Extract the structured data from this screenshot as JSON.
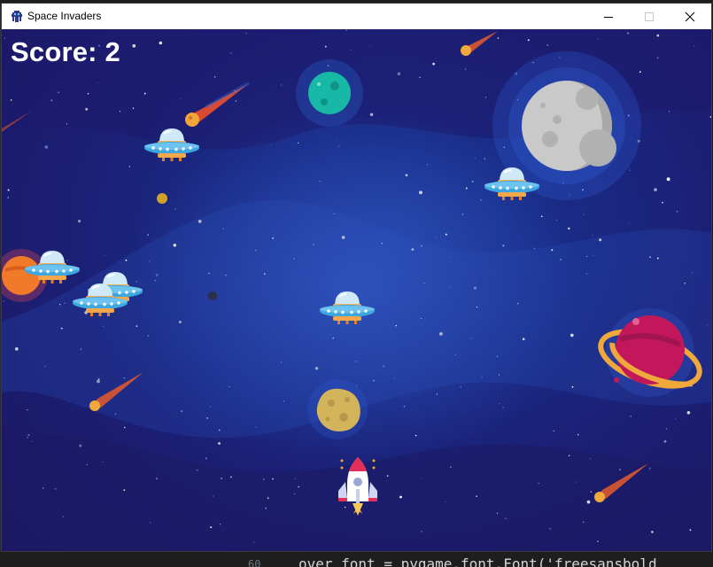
{
  "window": {
    "title": "Space Invaders",
    "app_icon": "space-invader-icon",
    "controls": [
      "minimize-icon",
      "maximize-icon",
      "close-icon"
    ]
  },
  "hud": {
    "score_text": "Score: 2"
  },
  "background_editor": {
    "code_text": "over_font = pygame.font.Font('freesansbold"
  },
  "colors": {
    "titlebar": "#ffffff",
    "space_dark": "#1c1660",
    "space_mid": "#1a2b86",
    "score_text": "#ffffff",
    "ufo_dome": "#cfe9f6",
    "ufo_body": "#3fa7e0",
    "ufo_lights": "#f4a64a"
  },
  "entities": {
    "player": "rocket-ship",
    "enemies": [
      "ufo",
      "ufo",
      "ufo",
      "ufo",
      "ufo",
      "ufo"
    ],
    "decor": [
      "green-planet",
      "moon",
      "orange-planet",
      "ringed-planet",
      "asteroid",
      "comet",
      "comet",
      "comet",
      "comet",
      "comet"
    ]
  }
}
